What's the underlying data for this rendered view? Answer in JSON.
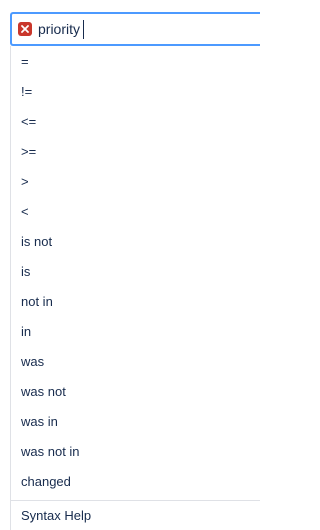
{
  "search": {
    "query": "priority",
    "clear_icon": "close-icon",
    "clear_color": "#c9372c",
    "focus_color": "#4c9aff"
  },
  "operators": [
    {
      "label": "="
    },
    {
      "label": "!="
    },
    {
      "label": "<="
    },
    {
      "label": ">="
    },
    {
      "label": ">"
    },
    {
      "label": "<"
    },
    {
      "label": "is not"
    },
    {
      "label": "is"
    },
    {
      "label": "not in"
    },
    {
      "label": "in"
    },
    {
      "label": "was"
    },
    {
      "label": "was not"
    },
    {
      "label": "was in"
    },
    {
      "label": "was not in"
    },
    {
      "label": "changed"
    }
  ],
  "footer": {
    "syntax_help": "Syntax Help"
  }
}
